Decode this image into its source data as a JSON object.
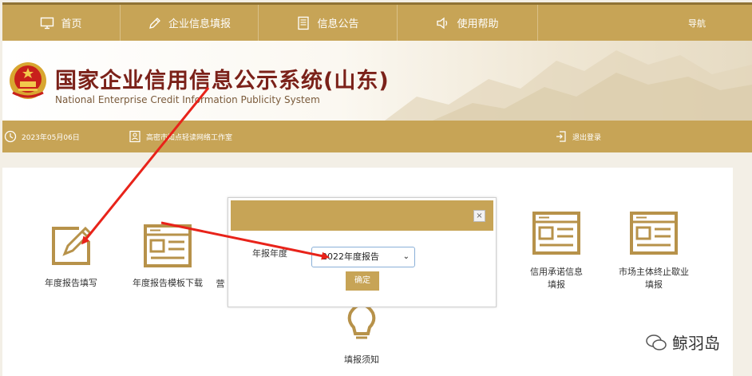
{
  "nav": {
    "items": [
      {
        "label": "首页",
        "icon": "monitor-icon"
      },
      {
        "label": "企业信息填报",
        "icon": "edit-icon"
      },
      {
        "label": "信息公告",
        "icon": "document-icon"
      },
      {
        "label": "使用帮助",
        "icon": "speaker-icon"
      }
    ],
    "right_label": "导航"
  },
  "header": {
    "title_cn": "国家企业信用信息公示系统(山东)",
    "title_en": "National Enterprise Credit Information Publicity System"
  },
  "infobar": {
    "date": "2023年05月06日",
    "company": "高密市知点轻读网络工作室",
    "logout": "退出登录"
  },
  "functions": {
    "annual_report_fill": "年度报告填写",
    "template_download": "年度报告模板下载",
    "partial_label": "营",
    "credit_commitment_line1": "信用承诺信息",
    "credit_commitment_line2": "填报",
    "termination_line1": "市场主体终止歇业",
    "termination_line2": "填报",
    "instructions": "填报须知"
  },
  "modal": {
    "label": "年报年度",
    "select_value": "2022年度报告",
    "confirm": "确定",
    "close": "×"
  },
  "watermark": {
    "text": "鲸羽岛"
  },
  "colors": {
    "gold": "#c7a456",
    "title_red": "#7b2119",
    "arrow_red": "#e8231a"
  }
}
